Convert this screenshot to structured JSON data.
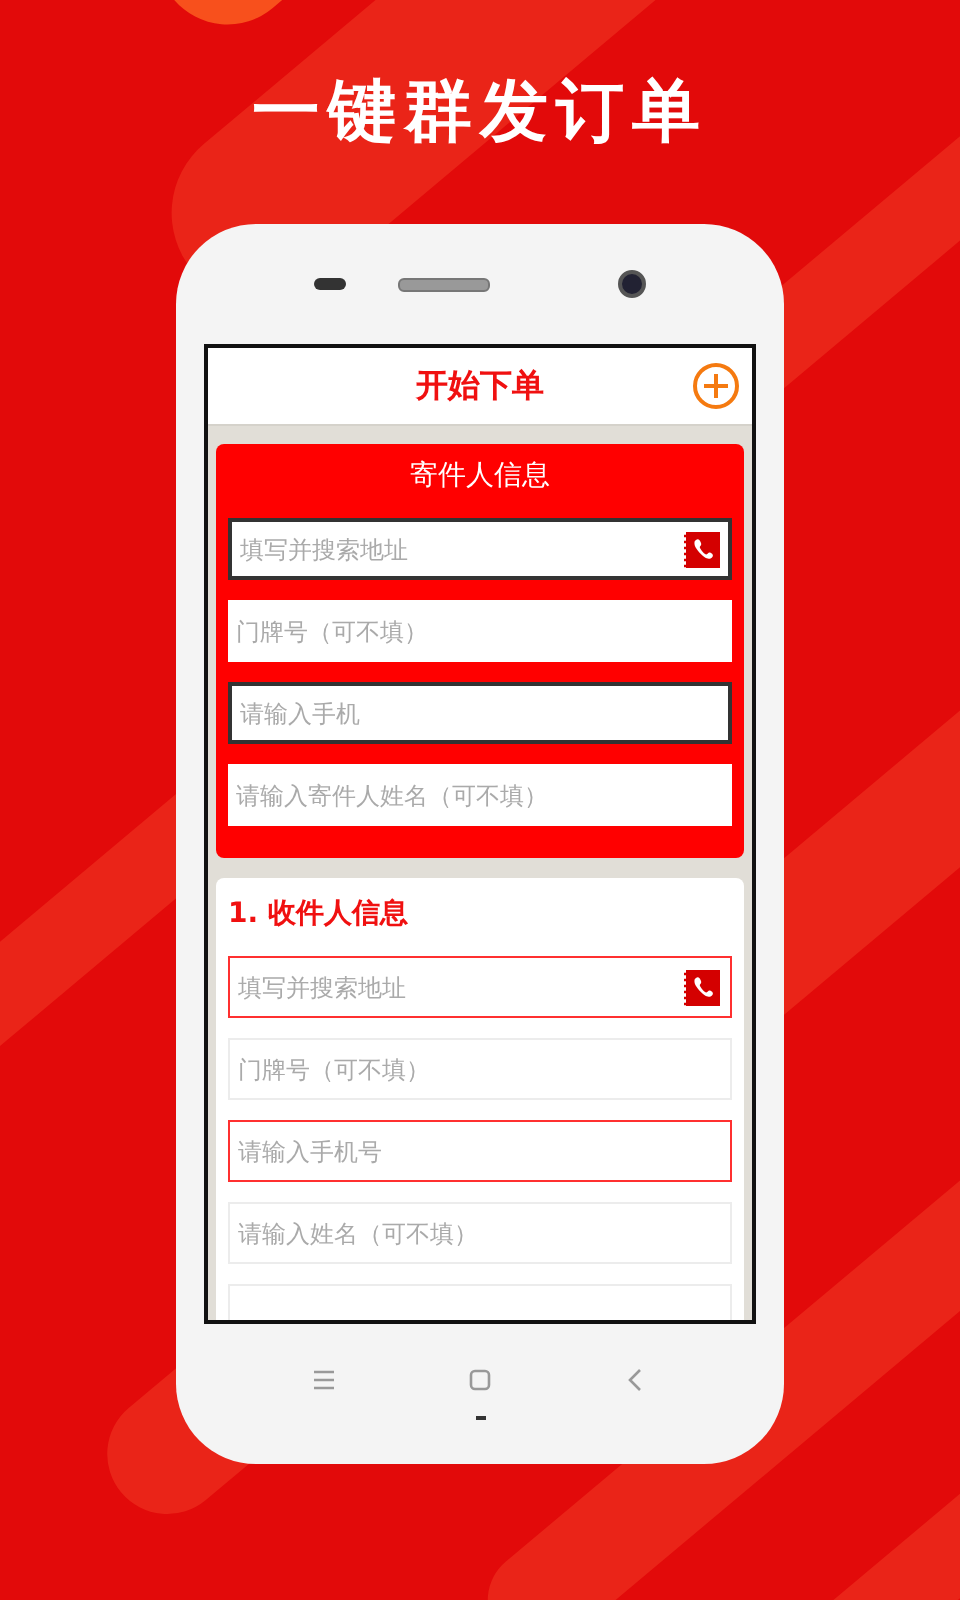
{
  "headline": "一键群发订单",
  "screen": {
    "title": "开始下单",
    "sections": [
      {
        "kind": "sender",
        "title": "寄件人信息",
        "fields": [
          {
            "placeholder": "填写并搜索地址",
            "emphasized": true,
            "contact_icon": true
          },
          {
            "placeholder": "门牌号（可不填）",
            "emphasized": false,
            "contact_icon": false
          },
          {
            "placeholder": "请输入手机",
            "emphasized": true,
            "contact_icon": false
          },
          {
            "placeholder": "请输入寄件人姓名（可不填）",
            "emphasized": false,
            "contact_icon": false
          }
        ]
      },
      {
        "kind": "recipient",
        "title": "1. 收件人信息",
        "fields": [
          {
            "placeholder": "填写并搜索地址",
            "emphasized": true,
            "contact_icon": true
          },
          {
            "placeholder": "门牌号（可不填）",
            "emphasized": false,
            "contact_icon": false
          },
          {
            "placeholder": "请输入手机号",
            "emphasized": true,
            "contact_icon": false
          },
          {
            "placeholder": "请输入姓名（可不填）",
            "emphasized": false,
            "contact_icon": false
          },
          {
            "emphasized": false,
            "contact_icon": false
          }
        ]
      }
    ]
  }
}
